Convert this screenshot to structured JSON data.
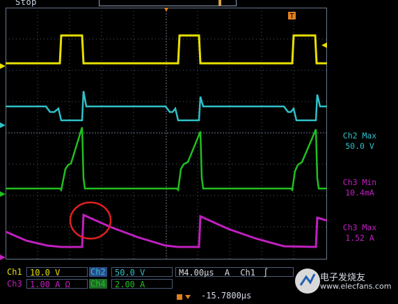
{
  "status": {
    "state": "Stop"
  },
  "side_readouts": [
    {
      "label": "Ch2 Max",
      "value": "50.0 V"
    },
    {
      "label": "Ch3 Min",
      "value": "10.4mA"
    },
    {
      "label": "Ch3 Max",
      "value": "1.52 A"
    }
  ],
  "channels": [
    {
      "name": "Ch1",
      "scale": "10.0 V",
      "color": "#e8e000"
    },
    {
      "name": "Ch2",
      "scale": "50.0 V",
      "color": "#30c0c8"
    },
    {
      "name": "Ch3",
      "scale": "1.00 A",
      "suffix": "Ω",
      "color": "#c020c0"
    },
    {
      "name": "Ch4",
      "scale": "2.00 A",
      "color": "#20c020"
    }
  ],
  "timebase": {
    "label": "M",
    "value": "4.00µs",
    "trigger_mode": "A",
    "trigger_source": "Ch1"
  },
  "trigger_position": {
    "value": "-15.7800µs"
  },
  "channel_markers": [
    "1",
    "2",
    "4",
    "3"
  ],
  "watermark": {
    "text": "电子发烧友",
    "url": "www.elecfans.com"
  },
  "colors": {
    "ch1": "#e8e000",
    "ch2": "#30c0c8",
    "ch3": "#c020c0",
    "ch4": "#20c020",
    "grid": "#6b7a8f",
    "annotation": "#e02020"
  }
}
